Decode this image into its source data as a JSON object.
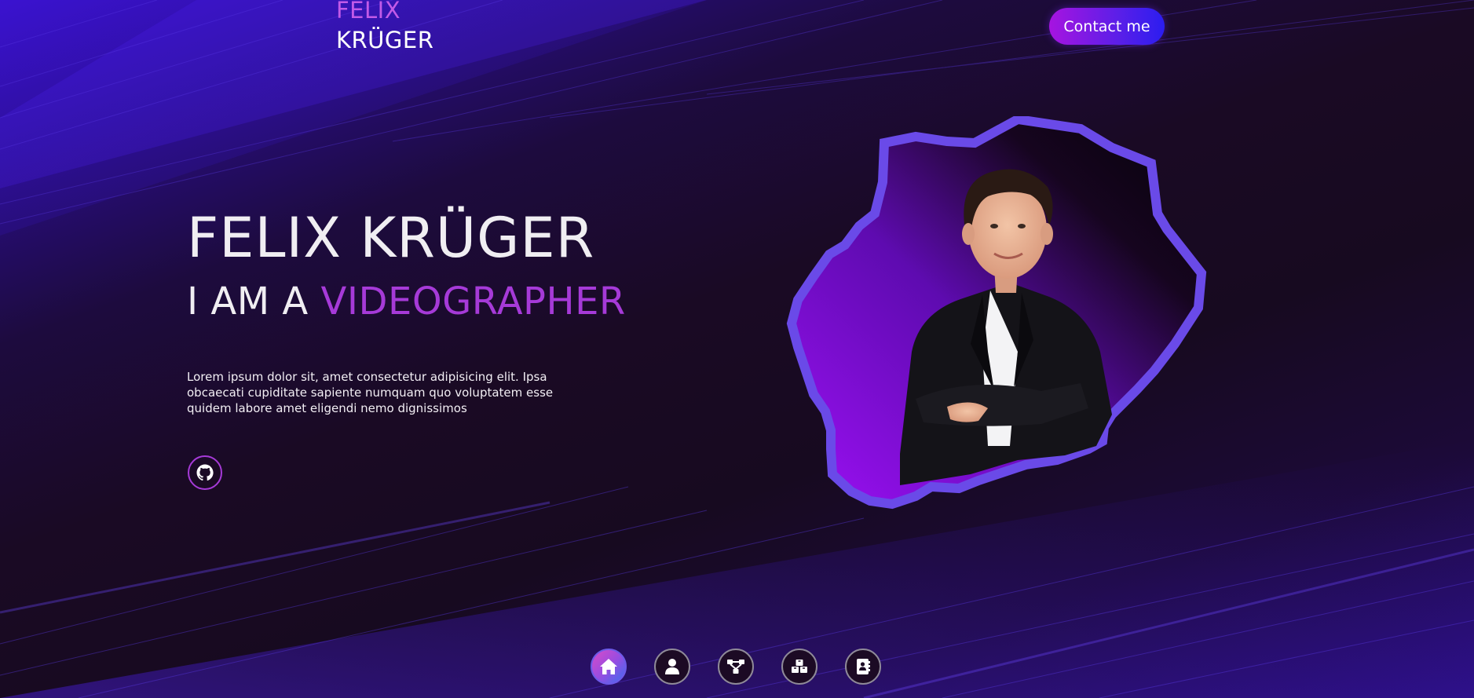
{
  "header": {
    "logo_first": "FELIX",
    "logo_last": "KRÜGER",
    "contact_label": "Contact me"
  },
  "hero": {
    "name": "FELIX KRÜGER",
    "role_prefix": "I AM A",
    "role_highlight": "VIDEOGRAPHER",
    "description": "Lorem ipsum dolor sit, amet consectetur adipisicing elit. Ipsa obcaecati cupiditate sapiente numquam quo voluptatem esse quidem labore amet eligendi nemo dignissimos"
  },
  "social": {
    "github_icon": "github-icon"
  },
  "dock": {
    "items": [
      {
        "icon": "home-icon",
        "active": true
      },
      {
        "icon": "user-icon",
        "active": false
      },
      {
        "icon": "network-icon",
        "active": false
      },
      {
        "icon": "boxes-icon",
        "active": false
      },
      {
        "icon": "contact-book-icon",
        "active": false
      }
    ]
  },
  "colors": {
    "accent_purple": "#a63ad8",
    "logo_pink": "#c25ae8",
    "frame_blue": "#6a4ae8",
    "background": "#1a0b22"
  }
}
